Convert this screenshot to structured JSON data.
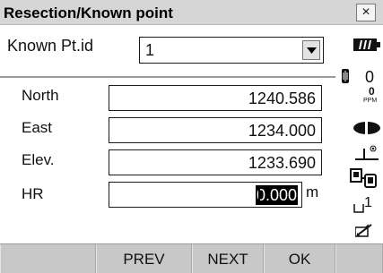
{
  "window": {
    "title": "Resection/Known point",
    "close_label": "×"
  },
  "known_point": {
    "label": "Known Pt.id",
    "selected_value": "1"
  },
  "fields": {
    "north": {
      "label": "North",
      "value": "1240.586"
    },
    "east": {
      "label": "East",
      "value": "1234.000"
    },
    "elev": {
      "label": "Elev.",
      "value": "1233.690"
    },
    "hr": {
      "label": "HR",
      "value": "0.000",
      "unit": "m"
    }
  },
  "status": {
    "memory_count": "0",
    "ppm_value": "0",
    "ppm_label": "PPM",
    "input_mode_number": "1"
  },
  "softkeys": [
    "",
    "PREV",
    "NEXT",
    "OK"
  ]
}
